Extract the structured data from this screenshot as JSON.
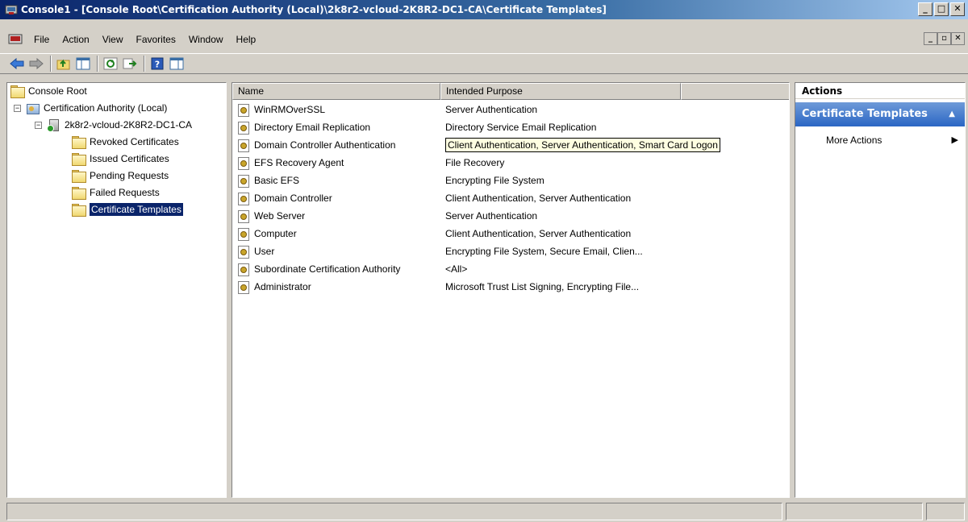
{
  "window": {
    "title": "Console1 - [Console Root\\Certification Authority (Local)\\2k8r2-vcloud-2K8R2-DC1-CA\\Certificate Templates]",
    "minimize": "_",
    "restore": "□",
    "close": "✕"
  },
  "menu": {
    "items": [
      "File",
      "Action",
      "View",
      "Favorites",
      "Window",
      "Help"
    ],
    "mdi_minimize": "_",
    "mdi_restore": "▫",
    "mdi_close": "✕"
  },
  "tree": {
    "root": "Console Root",
    "ca": "Certification Authority (Local)",
    "server": "2k8r2-vcloud-2K8R2-DC1-CA",
    "folders": [
      "Revoked Certificates",
      "Issued Certificates",
      "Pending Requests",
      "Failed Requests",
      "Certificate Templates"
    ],
    "selected_index": 4,
    "expanded_symbol": "−"
  },
  "list": {
    "columns": [
      "Name",
      "Intended Purpose"
    ],
    "rows": [
      {
        "name": "WinRMOverSSL",
        "purpose": "Server Authentication"
      },
      {
        "name": "Directory Email Replication",
        "purpose": "Directory Service Email Replication"
      },
      {
        "name": "Domain Controller Authentication",
        "purpose": "Client Authentication, Server Authentication, Smart Card Logon"
      },
      {
        "name": "EFS Recovery Agent",
        "purpose": "File Recovery"
      },
      {
        "name": "Basic EFS",
        "purpose": "Encrypting File System"
      },
      {
        "name": "Domain Controller",
        "purpose": "Client Authentication, Server Authentication"
      },
      {
        "name": "Web Server",
        "purpose": "Server Authentication"
      },
      {
        "name": "Computer",
        "purpose": "Client Authentication, Server Authentication"
      },
      {
        "name": "User",
        "purpose": "Encrypting File System, Secure Email, Clien..."
      },
      {
        "name": "Subordinate Certification Authority",
        "purpose": "<All>"
      },
      {
        "name": "Administrator",
        "purpose": "Microsoft Trust List Signing, Encrypting File..."
      }
    ]
  },
  "actions": {
    "title": "Actions",
    "section": "Certificate Templates",
    "collapse_symbol": "▲",
    "more": "More Actions",
    "more_arrow": "▶"
  },
  "colors": {
    "title_bar": "#0a246a",
    "selection": "#0a246a",
    "actions_header": "#2a66c4",
    "tooltip": "#ffffe1"
  },
  "icons": {
    "back": "back-arrow-icon",
    "forward": "forward-arrow-icon",
    "up": "up-folder-icon",
    "show_tree": "show-hide-tree-icon",
    "refresh": "refresh-icon",
    "export": "export-list-icon",
    "help": "help-icon",
    "show_action_pane": "show-action-pane-icon"
  }
}
